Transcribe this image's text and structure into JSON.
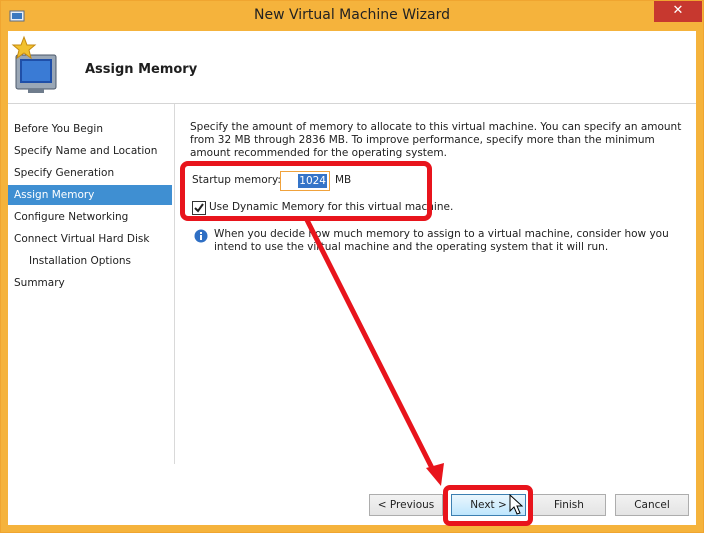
{
  "window": {
    "title": "New Virtual Machine Wizard",
    "close_glyph": "✕"
  },
  "header": {
    "title": "Assign Memory",
    "icon": "monitor-star-icon"
  },
  "steps": [
    {
      "label": "Before You Begin"
    },
    {
      "label": "Specify Name and Location"
    },
    {
      "label": "Specify Generation"
    },
    {
      "label": "Assign Memory"
    },
    {
      "label": "Configure Networking"
    },
    {
      "label": "Connect Virtual Hard Disk"
    },
    {
      "label": "Installation Options"
    },
    {
      "label": "Summary"
    }
  ],
  "selected_step": "Assign Memory",
  "main": {
    "description": "Specify the amount of memory to allocate to this virtual machine. You can specify an amount from 32 MB through 2836 MB. To improve performance, specify more than the minimum amount recommended for the operating system.",
    "startup_memory_label": "Startup memory:",
    "startup_memory_value": "1024",
    "startup_memory_unit": "MB",
    "dynamic_memory_label": "Use Dynamic Memory for this virtual machine.",
    "dynamic_memory_checked": true,
    "info_text": "When you decide how much memory to assign to a virtual machine, consider how you intend to use the virtual machine and the operating system that it will run."
  },
  "buttons": {
    "previous": "< Previous",
    "next": "Next >",
    "finish": "Finish",
    "cancel": "Cancel"
  },
  "colors": {
    "titlebar": "#f5b33c",
    "selection": "#3f8fd2",
    "annotation": "#e8141c"
  }
}
